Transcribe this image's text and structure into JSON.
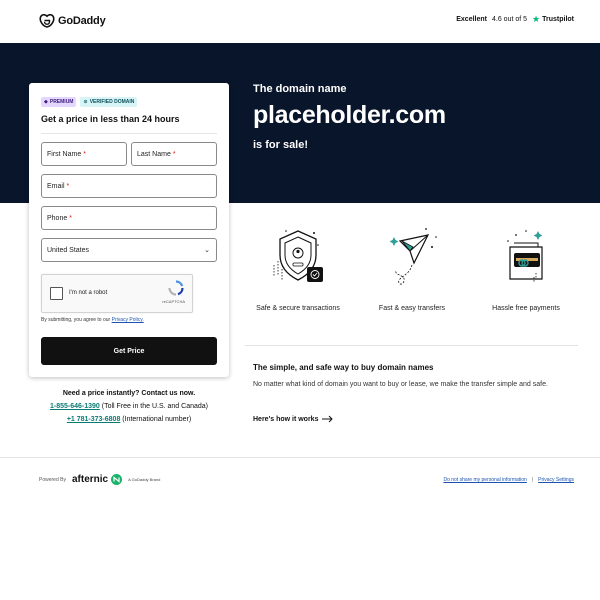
{
  "header": {
    "logo_text": "GoDaddy",
    "rating_word": "Excellent",
    "rating_score": "4.6 out of 5",
    "trustpilot": "Trustpilot"
  },
  "hero": {
    "label": "The domain name",
    "domain": "placeholder.com",
    "sale": "is for sale!"
  },
  "form": {
    "badge_premium": "PREMIUM",
    "badge_verified": "VERIFIED DOMAIN",
    "title": "Get a price in less than 24 hours",
    "first_name": "First Name",
    "last_name": "Last Name",
    "email": "Email",
    "phone": "Phone",
    "required_mark": "*",
    "country": "United States",
    "captcha_text": "I'm not a robot",
    "captcha_brand": "reCAPTCHA",
    "consent_prefix": "By submitting, you agree to our",
    "consent_link": "Privacy Policy.",
    "submit": "Get Price"
  },
  "contact": {
    "question": "Need a price instantly? Contact us now.",
    "phone1": "1-855-646-1390",
    "phone1_note": "(Toll Free in the U.S. and Canada)",
    "phone2": "+1 781-373-6808",
    "phone2_note": "(International number)"
  },
  "features": [
    {
      "label": "Safe & secure transactions",
      "icon": "shield-icon"
    },
    {
      "label": "Fast & easy transfers",
      "icon": "paper-plane-icon"
    },
    {
      "label": "Hassle free payments",
      "icon": "wallet-icon"
    }
  ],
  "info": {
    "title": "The simple, and safe way to buy domain names",
    "desc": "No matter what kind of domain you want to buy or lease, we make the transfer simple and safe.",
    "link": "Here's how it works"
  },
  "footer": {
    "powered_by": "Powered By",
    "afternic": "afternic",
    "brand_note": "A GoDaddy Brand",
    "privacy_link": "Do not share my personal information",
    "settings_link": "Privacy Settings"
  },
  "colors": {
    "hero_bg": "#09152a",
    "accent_teal": "#0a7a75",
    "trustpilot_green": "#00b67a",
    "button_bg": "#111111"
  }
}
